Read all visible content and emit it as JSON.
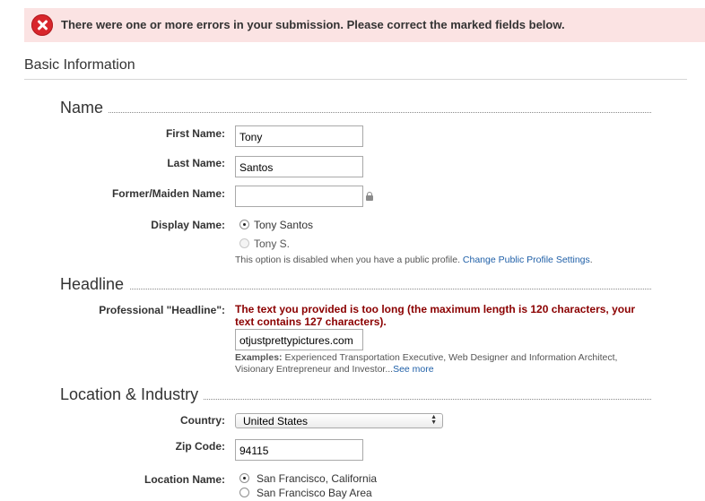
{
  "error_banner": {
    "message": "There were one or more errors in your submission. Please correct the marked fields below."
  },
  "section": {
    "title": "Basic Information"
  },
  "name_group": {
    "title": "Name",
    "first_name": {
      "label": "First Name:",
      "value": "Tony"
    },
    "last_name": {
      "label": "Last Name:",
      "value": "Santos"
    },
    "former_name": {
      "label": "Former/Maiden Name:",
      "value": ""
    },
    "display_name": {
      "label": "Display Name:",
      "options": [
        {
          "label": "Tony Santos",
          "selected": true
        },
        {
          "label": "Tony S.",
          "selected": false
        }
      ],
      "help_text": "This option is disabled when you have a public profile.",
      "help_link": "Change Public Profile Settings",
      "help_end": "."
    }
  },
  "headline_group": {
    "title": "Headline",
    "label": "Professional \"Headline\":",
    "error": "The text you provided is too long (the maximum length is 120 characters, your text contains 127 characters).",
    "value": "otjustprettypictures.com",
    "examples_label": "Examples:",
    "examples_text": " Experienced Transportation Executive, Web Designer and Information Architect,",
    "examples_text2": "Visionary Entrepreneur and Investor...",
    "see_more": "See more"
  },
  "location_group": {
    "title": "Location & Industry",
    "country": {
      "label": "Country:",
      "value": "United States"
    },
    "zip": {
      "label": "Zip Code:",
      "value": "94115"
    },
    "location_name": {
      "label": "Location Name:",
      "options": [
        {
          "label": "San Francisco, California",
          "selected": true
        },
        {
          "label": "San Francisco Bay Area",
          "selected": false
        }
      ]
    }
  },
  "colors": {
    "error_banner_bg": "#fbe3e3",
    "error_text": "#8b0000",
    "link": "#2060a8"
  }
}
